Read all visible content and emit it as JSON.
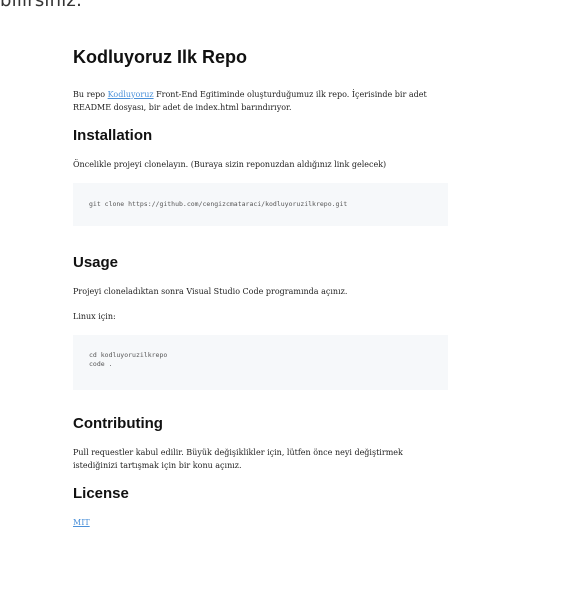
{
  "top_partial_text": "bilirsiniz.",
  "readme": {
    "title": "Kodluyoruz Ilk Repo",
    "intro": {
      "before": "Bu repo ",
      "link": "Kodluyoruz",
      "after": " Front-End Egitiminde oluşturduğumuz ilk repo. İçerisinde bir adet README dosyası, bir adet de index.html barındırıyor."
    },
    "installation": {
      "heading": "Installation",
      "text": "Öncelikle projeyi clonelayın. (Buraya sizin reponuzdan aldığınız link gelecek)",
      "code": "git clone https://github.com/cengizcmataraci/kodluyoruzilkrepo.git"
    },
    "usage": {
      "heading": "Usage",
      "text": "Projeyi cloneladıktan sonra Visual Studio Code programında açınız.",
      "linux_label": "Linux için:",
      "code": "cd kodluyoruzilkrepo\ncode ."
    },
    "contributing": {
      "heading": "Contributing",
      "text": "Pull requestler kabul edilir. Büyük değişiklikler için, lütfen önce neyi değiştirmek istediğinizi tartışmak için bir konu açınız."
    },
    "license": {
      "heading": "License",
      "link": "MIT"
    }
  }
}
